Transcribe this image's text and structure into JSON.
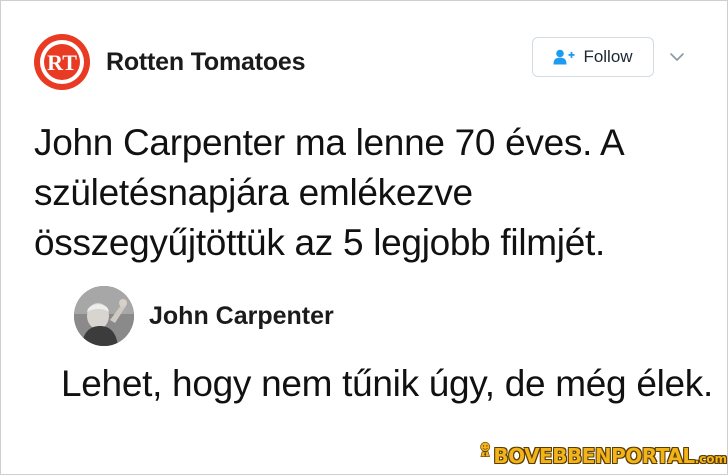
{
  "tweet": {
    "account_name": "Rotten Tomatoes",
    "logo_text": "RT",
    "follow_label": "Follow",
    "text": "John Carpenter ma lenne 70 éves. A születésnapjára emlékezve összegyűjtöttük az 5 legjobb filmjét."
  },
  "reply": {
    "name": "John Carpenter",
    "text": "Lehet, hogy nem tűnik úgy, de még élek."
  },
  "watermark": {
    "main": "BOVEBBENPORTAL",
    "suffix": ".com"
  },
  "colors": {
    "brand_red": "#e93b23",
    "follow_blue": "#1d9bf0",
    "watermark_gold": "#f2b418"
  },
  "icons": {
    "follow": "add-user-icon",
    "menu": "chevron-down-icon"
  }
}
